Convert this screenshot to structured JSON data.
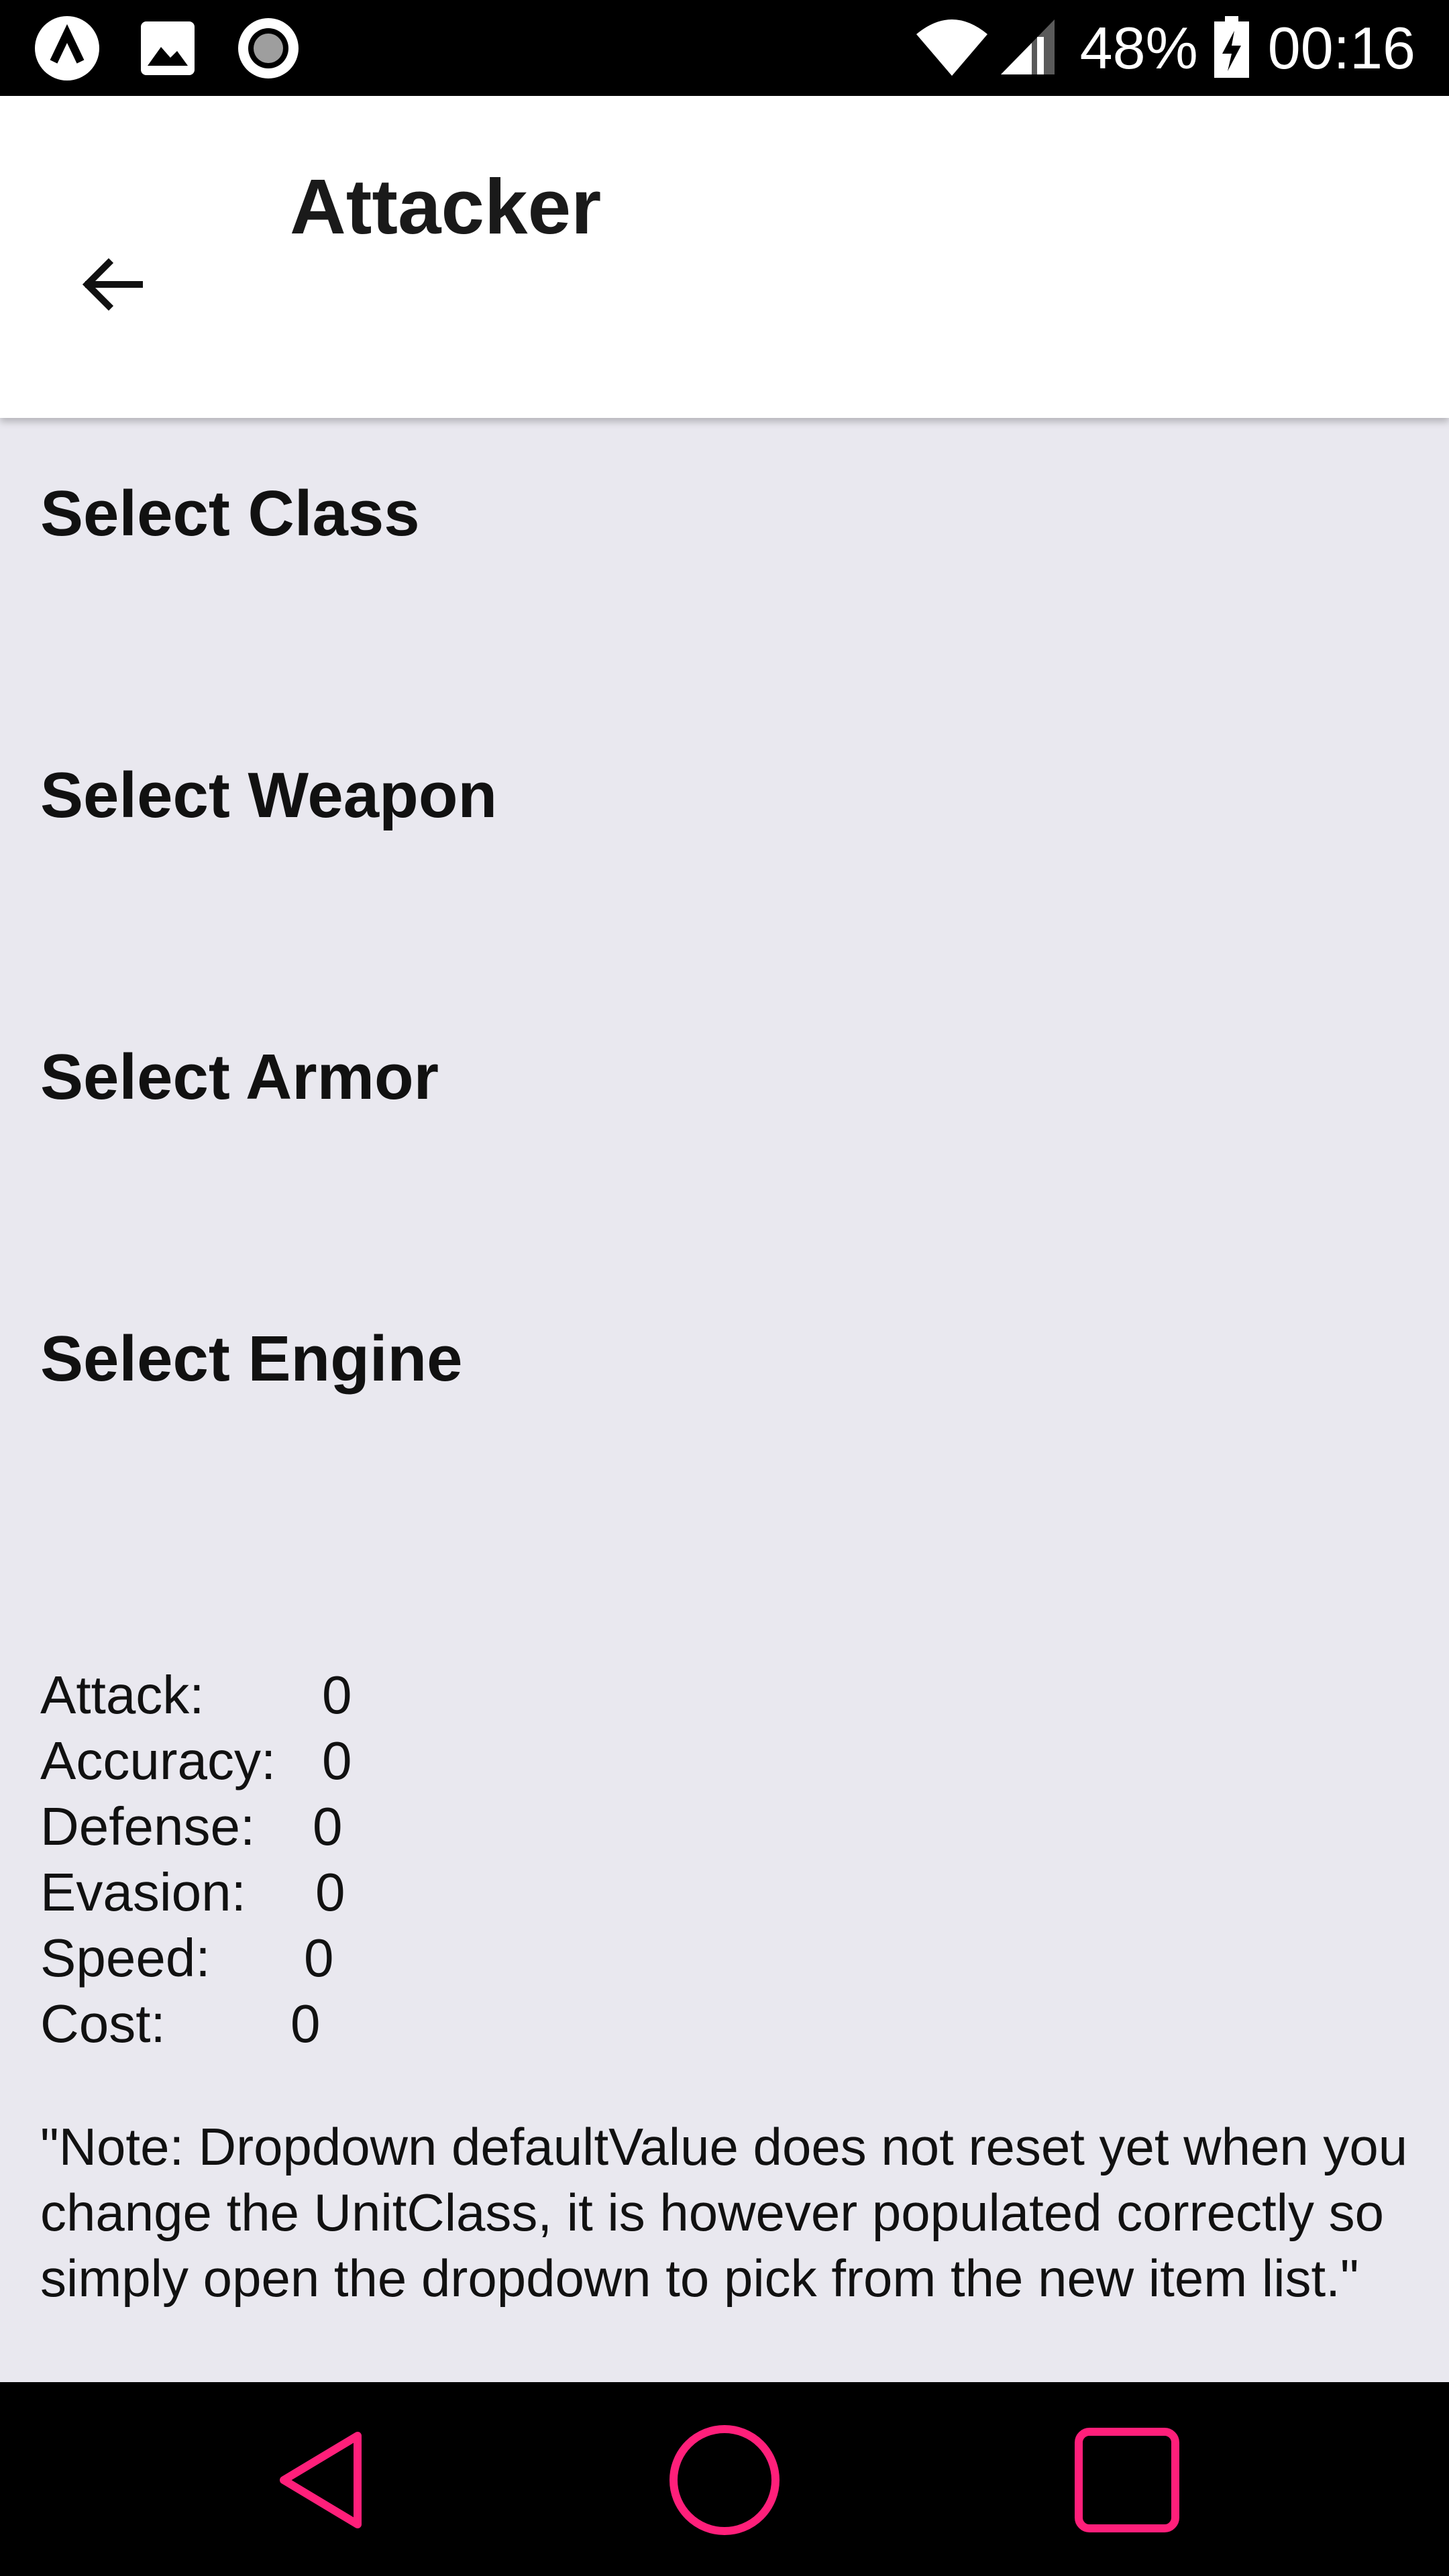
{
  "status_bar": {
    "icons_left": [
      "app-logo-icon",
      "image-icon",
      "record-icon"
    ],
    "icons_right": [
      "wifi-icon",
      "signal-icon",
      "battery-charging-icon"
    ],
    "battery": "48%",
    "time": "00:16"
  },
  "app_bar": {
    "back_icon": "arrow-back-icon",
    "title": "Attacker"
  },
  "sections": [
    {
      "label": "Select Class"
    },
    {
      "label": "Select Weapon"
    },
    {
      "label": "Select Armor"
    },
    {
      "label": "Select Engine"
    }
  ],
  "stats": [
    {
      "label": "Attack:",
      "value": "0"
    },
    {
      "label": "Accuracy:",
      "value": "0"
    },
    {
      "label": "Defense:",
      "value": "0"
    },
    {
      "label": "Evasion:",
      "value": "0"
    },
    {
      "label": "Speed:",
      "value": "0"
    },
    {
      "label": "Cost:",
      "value": "0"
    }
  ],
  "note": "\"Note: Dropdown defaultValue does not reset yet when you change the UnitClass, it is however populated correctly so simply open the dropdown to pick from the new item list.\"",
  "nav_bar": {
    "buttons": [
      "nav-back-icon",
      "nav-home-icon",
      "nav-recents-icon"
    ],
    "accent_color": "#ff1f7a"
  }
}
